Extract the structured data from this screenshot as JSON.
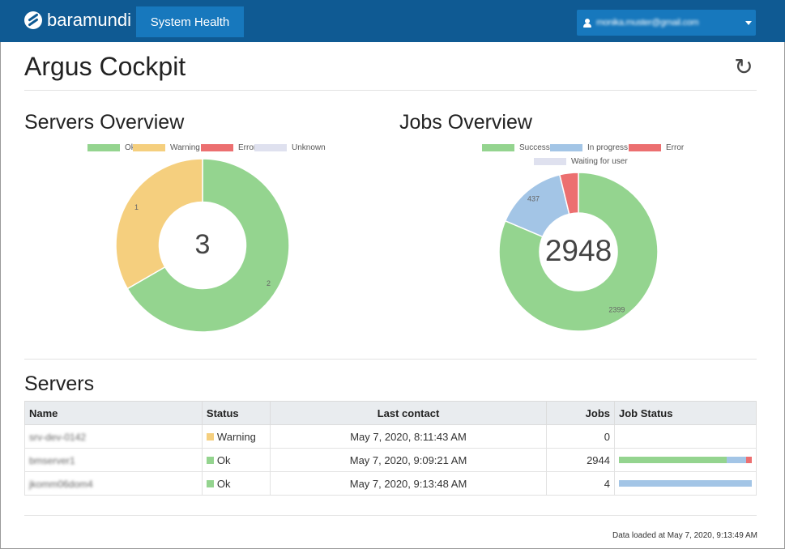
{
  "nav": {
    "brand": "baramundi",
    "tab": "System Health",
    "user_email": "monika.muster@gmail.com"
  },
  "page": {
    "title": "Argus Cockpit"
  },
  "servers_overview": {
    "title": "Servers Overview",
    "legend": [
      "Ok",
      "Warning",
      "Error",
      "Unknown"
    ],
    "total": "3",
    "slices": [
      {
        "label": "Ok",
        "value": 2,
        "color": "#94d48f"
      },
      {
        "label": "Warning",
        "value": 1,
        "color": "#f5cf7e"
      },
      {
        "label": "Error",
        "value": 0,
        "color": "#ec6f70"
      },
      {
        "label": "Unknown",
        "value": 0,
        "color": "#dfe1ef"
      }
    ]
  },
  "jobs_overview": {
    "title": "Jobs Overview",
    "legend": [
      "Success",
      "In progress",
      "Error",
      "Waiting for user"
    ],
    "total": "2948",
    "slices": [
      {
        "label": "Success",
        "value": 2399,
        "color": "#94d48f"
      },
      {
        "label": "In progress",
        "value": 437,
        "color": "#a3c5e6"
      },
      {
        "label": "Error",
        "value": 112,
        "color": "#ec6f70"
      },
      {
        "label": "Waiting for user",
        "value": 0,
        "color": "#dfe1ef"
      }
    ]
  },
  "servers": {
    "title": "Servers",
    "columns": [
      "Name",
      "Status",
      "Last contact",
      "Jobs",
      "Job Status"
    ],
    "rows": [
      {
        "name": "srv-dev-0142",
        "status": "Warning",
        "status_color": "#f5cf7e",
        "last_contact": "May 7, 2020, 8:11:43 AM",
        "jobs": "0",
        "job_status": []
      },
      {
        "name": "bmserver1",
        "status": "Ok",
        "status_color": "#94d48f",
        "last_contact": "May 7, 2020, 9:09:21 AM",
        "jobs": "2944",
        "job_status": [
          {
            "value": 0.81,
            "color": "#94d48f"
          },
          {
            "value": 0.15,
            "color": "#a3c5e6"
          },
          {
            "value": 0.04,
            "color": "#ec6f70"
          }
        ]
      },
      {
        "name": "jkomm06dom4",
        "status": "Ok",
        "status_color": "#94d48f",
        "last_contact": "May 7, 2020, 9:13:48 AM",
        "jobs": "4",
        "job_status": [
          {
            "value": 1.0,
            "color": "#a3c5e6"
          }
        ]
      }
    ]
  },
  "footer": {
    "loaded": "Data loaded at May 7, 2020, 9:13:49 AM"
  }
}
